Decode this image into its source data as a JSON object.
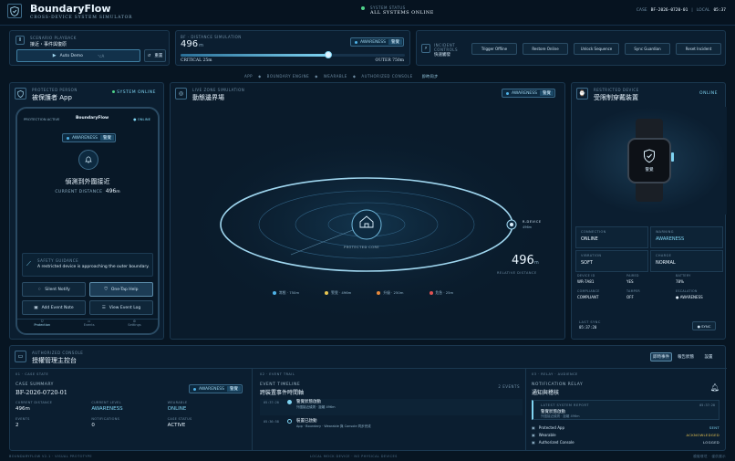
{
  "brand": {
    "name": "BoundaryFlow",
    "subtitle": "CROSS-DEVICE SYSTEM SIMULATOR"
  },
  "status": {
    "label": "SYSTEM STATUS",
    "value": "ALL SYSTEMS ONLINE"
  },
  "case_header": {
    "case_label": "CASE",
    "case_id": "BF-2026-0720-01",
    "local_label": "LOCAL",
    "local_time": "05:37"
  },
  "scenario": {
    "label": "SCENARIO PLAYBACK",
    "value": "接近・事件與復原",
    "auto_demo": "Auto Demo",
    "auto_key": "⌥A",
    "reset": "重置"
  },
  "distance_sim": {
    "label": "BF · DISTANCE SIMULATION",
    "value": "496",
    "unit": "m",
    "chip": "AWARENESS",
    "chip_sub": "警覺",
    "min_label": "CRITICAL 25m",
    "max_label": "OUTER 750m",
    "fill_percent": 66
  },
  "presets": {
    "label": "INCIDENT CONTROLS",
    "sub": "快速觸發",
    "buttons": [
      "Trigger Offline",
      "Restore Online",
      "Unlock Sequence",
      "Sync Guardian",
      "Reset Incident"
    ]
  },
  "channel_nav": {
    "items": [
      "APP",
      "BOUNDARY ENGINE",
      "WEARABLE",
      "AUTHORIZED CONSOLE"
    ],
    "tail": "即時同步"
  },
  "protected_person": {
    "label": "PROTECTED PERSON",
    "title": "被保護者 App",
    "status": "SYSTEM ONLINE"
  },
  "phone": {
    "left_tag": "PROTECTION ACTIVE",
    "brand": "BoundaryFlow",
    "online": "● ONLINE",
    "chip": "AWARENESS",
    "chip_sub": "警覺",
    "alert_title": "偵測到外圍接近",
    "distance_label": "CURRENT DISTANCE",
    "distance_value": "496",
    "distance_unit": "m",
    "guidance_label": "SAFETY GUIDANCE",
    "guidance_text": "A restricted device is approaching the outer boundary.",
    "actions": [
      "Silent Notify",
      "One-Tap Help",
      "Add Event Note",
      "View Event Log"
    ],
    "tabs": [
      "Protection",
      "Events",
      "Settings"
    ]
  },
  "zone": {
    "label": "LIVE ZONE SIMULATION",
    "title": "動態邊界場",
    "chip": "AWARENESS",
    "chip_sub": "警覺",
    "core_label": "PROTECTED CORE",
    "device_label": "R-DEVICE",
    "device_sub": "496m",
    "distance_value": "496",
    "distance_unit": "m",
    "distance_label": "RELATIVE DISTANCE",
    "legend": [
      {
        "name": "常態 · 750m",
        "color": "#4fb3e8"
      },
      {
        "name": "警覺 · 496m",
        "color": "#e8c552"
      },
      {
        "name": "升級 · 250m",
        "color": "#e88a3c"
      },
      {
        "name": "危急 · 25m",
        "color": "#e05252"
      }
    ]
  },
  "restricted": {
    "label": "RESTRICTED DEVICE",
    "title": "受限制穿戴裝置",
    "status": "ONLINE",
    "watch_label": "警覺",
    "stats": [
      {
        "k": "CONNECTION",
        "v": "ONLINE"
      },
      {
        "k": "WARNING",
        "v": "AWARENESS"
      },
      {
        "k": "VIBRATION",
        "v": "SOFT"
      },
      {
        "k": "CHARGE",
        "v": "NORMAL"
      }
    ],
    "meta": [
      {
        "k": "DEVICE ID",
        "v": "WR-7A81"
      },
      {
        "k": "PAIRED",
        "v": "YES"
      },
      {
        "k": "BATTERY",
        "v": "78%"
      },
      {
        "k": "COMPLIANCE",
        "v": "COMPLIANT"
      },
      {
        "k": "TAMPER",
        "v": "OFF"
      },
      {
        "k": "ESCALATION",
        "v": "● AWARENESS"
      }
    ],
    "last_sync_label": "LAST SYNC",
    "last_sync": "05:37:20",
    "sync_btn": "● SYNC"
  },
  "console": {
    "label": "AUTHORIZED CONSOLE",
    "title": "授權管理主控台",
    "tabs": [
      "即時事件",
      "報告狀態",
      "設置"
    ],
    "case_summary": {
      "section": "01 · CASE STATE",
      "label": "CASE SUMMARY",
      "case_id": "BF-2026-0720-01",
      "chip": "AWARENESS",
      "chip_sub": "警覺",
      "fields": [
        {
          "k": "CURRENT DISTANCE",
          "v": "496m"
        },
        {
          "k": "CURRENT LEVEL",
          "v": "AWARENESS"
        },
        {
          "k": "WEARABLE",
          "v": "ONLINE"
        },
        {
          "k": "EVENTS",
          "v": "2"
        },
        {
          "k": "NOTIFICATIONS",
          "v": "0"
        },
        {
          "k": "CASE STATUS",
          "v": "ACTIVE"
        }
      ]
    },
    "timeline": {
      "section": "02 · EVENT TRAIL",
      "label": "EVENT TIMELINE",
      "title": "跨裝置事件時間軸",
      "count_label": "2 EVENTS",
      "events": [
        {
          "time": "05:37:20",
          "title": "警覺狀態啟動",
          "desc": "外圍接近偵測 · 距離 496m"
        },
        {
          "time": "05:36:58",
          "title": "裝置已啟動",
          "desc": "App · Boundary · Wearable 與 Console 同步完成"
        }
      ]
    },
    "relay": {
      "section": "03 · RELAY · AUDIENCE",
      "label": "NOTIFICATION RELAY",
      "title": "通知與稽核",
      "latest_label": "LATEST SYSTEM REPORT",
      "latest_time": "05:37:20",
      "latest_title": "警覺狀態啟動",
      "latest_desc": "外圍接近偵測 · 距離 496m",
      "rows": [
        {
          "k": "Protected App",
          "v": "SENT",
          "color": "#7fd4f2"
        },
        {
          "k": "Wearable",
          "v": "ACKNOWLEDGED",
          "color": "#e8c552"
        },
        {
          "k": "Authorized Console",
          "v": "LOGGED",
          "color": "#cfe3f2"
        }
      ]
    }
  },
  "footer": {
    "left": "BOUNDARYFLOW V2.1 · VISUAL PROTOTYPE",
    "center": "LOCAL MOCK DEVICE · NO PHYSICAL DEVICES",
    "right": "模擬環境 · 僅供展示"
  }
}
